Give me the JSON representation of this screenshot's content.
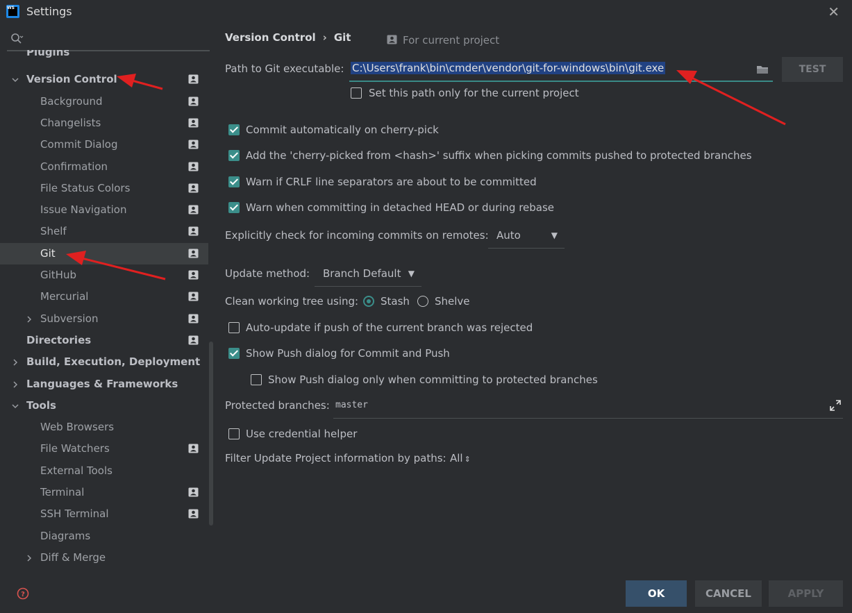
{
  "window": {
    "title": "Settings",
    "logo_text": "WS"
  },
  "sidebar": {
    "search_placeholder": "",
    "items": [
      {
        "label": "Plugins",
        "bold": true,
        "indent": 0,
        "arrow": "",
        "icon": false,
        "partial": true
      },
      {
        "label": "Version Control",
        "bold": true,
        "indent": 0,
        "arrow": "down",
        "icon": true
      },
      {
        "label": "Background",
        "bold": false,
        "indent": 1,
        "arrow": "",
        "icon": true
      },
      {
        "label": "Changelists",
        "bold": false,
        "indent": 1,
        "arrow": "",
        "icon": true
      },
      {
        "label": "Commit Dialog",
        "bold": false,
        "indent": 1,
        "arrow": "",
        "icon": true
      },
      {
        "label": "Confirmation",
        "bold": false,
        "indent": 1,
        "arrow": "",
        "icon": true
      },
      {
        "label": "File Status Colors",
        "bold": false,
        "indent": 1,
        "arrow": "",
        "icon": true
      },
      {
        "label": "Issue Navigation",
        "bold": false,
        "indent": 1,
        "arrow": "",
        "icon": true
      },
      {
        "label": "Shelf",
        "bold": false,
        "indent": 1,
        "arrow": "",
        "icon": true
      },
      {
        "label": "Git",
        "bold": false,
        "indent": 1,
        "arrow": "",
        "icon": true,
        "selected": true
      },
      {
        "label": "GitHub",
        "bold": false,
        "indent": 1,
        "arrow": "",
        "icon": true
      },
      {
        "label": "Mercurial",
        "bold": false,
        "indent": 1,
        "arrow": "",
        "icon": true
      },
      {
        "label": "Subversion",
        "bold": false,
        "indent": 1,
        "arrow": "right",
        "icon": true
      },
      {
        "label": "Directories",
        "bold": true,
        "indent": 0,
        "arrow": "",
        "icon": true
      },
      {
        "label": "Build, Execution, Deployment",
        "bold": true,
        "indent": 0,
        "arrow": "right",
        "icon": false
      },
      {
        "label": "Languages & Frameworks",
        "bold": true,
        "indent": 0,
        "arrow": "right",
        "icon": false
      },
      {
        "label": "Tools",
        "bold": true,
        "indent": 0,
        "arrow": "down",
        "icon": false
      },
      {
        "label": "Web Browsers",
        "bold": false,
        "indent": 1,
        "arrow": "",
        "icon": false
      },
      {
        "label": "File Watchers",
        "bold": false,
        "indent": 1,
        "arrow": "",
        "icon": true
      },
      {
        "label": "External Tools",
        "bold": false,
        "indent": 1,
        "arrow": "",
        "icon": false
      },
      {
        "label": "Terminal",
        "bold": false,
        "indent": 1,
        "arrow": "",
        "icon": true
      },
      {
        "label": "SSH Terminal",
        "bold": false,
        "indent": 1,
        "arrow": "",
        "icon": true
      },
      {
        "label": "Diagrams",
        "bold": false,
        "indent": 1,
        "arrow": "",
        "icon": false
      },
      {
        "label": "Diff & Merge",
        "bold": false,
        "indent": 1,
        "arrow": "right",
        "icon": false
      }
    ]
  },
  "main": {
    "breadcrumb": {
      "parent": "Version Control",
      "separator": "›",
      "current": "Git"
    },
    "for_project": "For current project",
    "path_label": "Path to Git executable:",
    "path_value": "C:\\Users\\frank\\bin\\cmder\\vendor\\git-for-windows\\bin\\git.exe",
    "test_button": "TEST",
    "set_path_only": {
      "label": "Set this path only for the current project",
      "checked": false
    },
    "checkboxes": [
      {
        "label": "Commit automatically on cherry-pick",
        "checked": true
      },
      {
        "label": "Add the 'cherry-picked from <hash>' suffix when picking commits pushed to protected branches",
        "checked": true
      },
      {
        "label": "Warn if CRLF line separators are about to be committed",
        "checked": true
      },
      {
        "label": "Warn when committing in detached HEAD or during rebase",
        "checked": true
      }
    ],
    "incoming_label": "Explicitly check for incoming commits on remotes:",
    "incoming_value": "Auto",
    "update_method_label": "Update method:",
    "update_method_value": "Branch Default",
    "clean_label": "Clean working tree using:",
    "clean_options": [
      {
        "label": "Stash",
        "selected": true
      },
      {
        "label": "Shelve",
        "selected": false
      }
    ],
    "auto_update": {
      "label": "Auto-update if push of the current branch was rejected",
      "checked": false
    },
    "show_push": {
      "label": "Show Push dialog for Commit and Push",
      "checked": true
    },
    "show_push_protected": {
      "label": "Show Push dialog only when committing to protected branches",
      "checked": false
    },
    "protected_label": "Protected branches:",
    "protected_value": "master",
    "credential_helper": {
      "label": "Use credential helper",
      "checked": false
    },
    "filter_label": "Filter Update Project information by paths:",
    "filter_value": "All"
  },
  "buttons": {
    "ok": "OK",
    "cancel": "CANCEL",
    "apply": "APPLY"
  },
  "colors": {
    "background": "#2b2d30",
    "accent": "#3b8e8a",
    "selection": "#214283",
    "annotation_arrow": "#e02020"
  }
}
